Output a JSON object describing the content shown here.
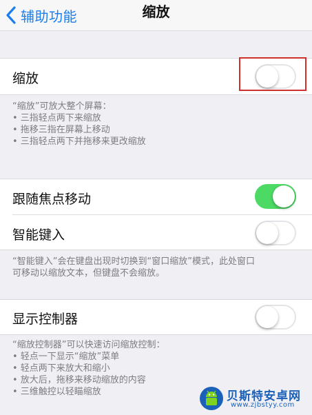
{
  "navbar": {
    "back_label": "辅助功能",
    "title": "缩放"
  },
  "zoom": {
    "label": "缩放",
    "state": "off",
    "highlight_color": "#d0302c"
  },
  "zoom_footer": {
    "lines": [
      "“缩放”可放大整个屏幕：",
      "• 三指轻点两下来缩放",
      "• 拖移三指在屏幕上移动",
      "• 三指轻点两下并拖移来更改缩放"
    ]
  },
  "follow_focus": {
    "label": "跟随焦点移动",
    "state": "on"
  },
  "smart_typing": {
    "label": "智能键入",
    "state": "off"
  },
  "smart_typing_footer": {
    "lines": [
      "“智能键入”会在键盘出现时切换到“窗口缩放”模式，此处窗口",
      "可移动以缩放文本，但键盘不会缩放。"
    ]
  },
  "show_controller": {
    "label": "显示控制器",
    "state": "off"
  },
  "controller_footer": {
    "lines": [
      "“缩放控制器”可以快速访问缩放控制：",
      "• 轻点一下显示“缩放”菜单",
      "• 轻点两下来放大和缩小",
      "• 放大后，拖移来移动缩放的内容",
      "• 三维触控以轻瞄缩放"
    ]
  },
  "watermark": {
    "title": "贝斯特安卓网",
    "url": "www.zjbstyy.com"
  },
  "colors": {
    "accent": "#1a7ef0",
    "switch_on": "#4cd964",
    "background": "#efeff4"
  }
}
